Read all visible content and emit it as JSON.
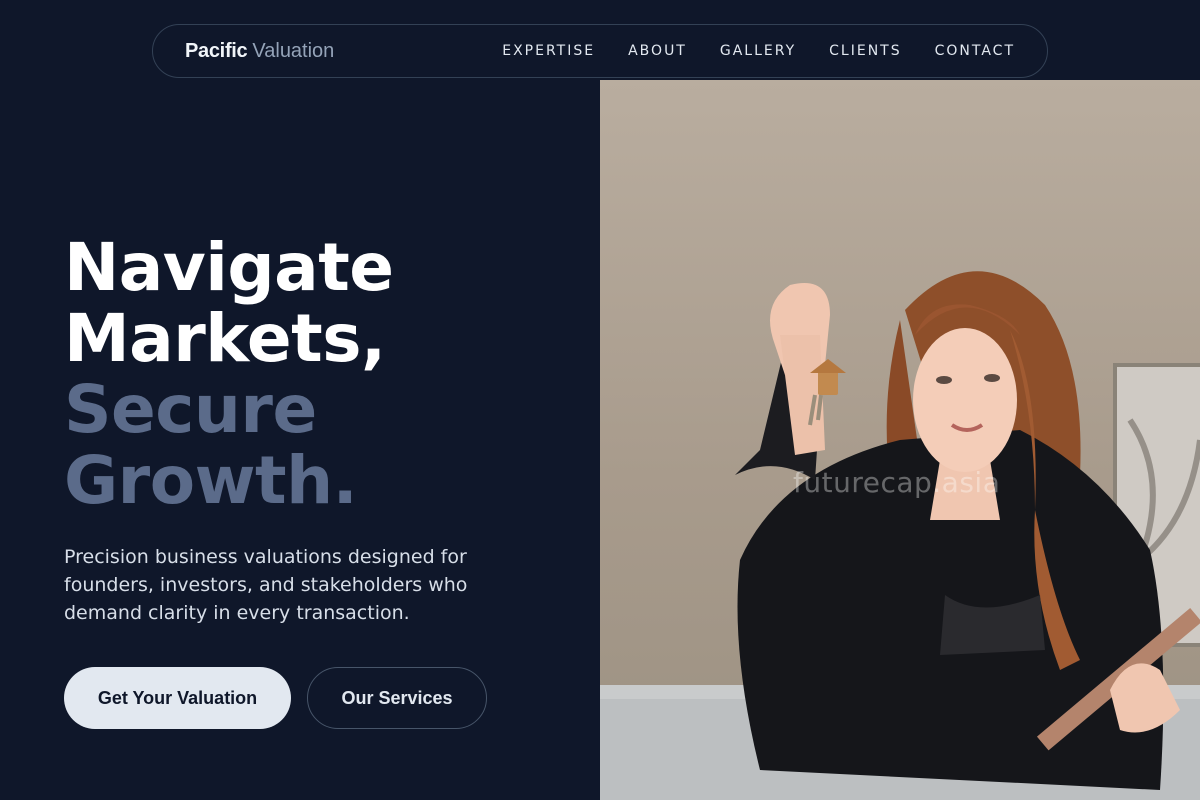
{
  "brand": {
    "bold": "Pacific",
    "light": "Valuation"
  },
  "nav": {
    "items": [
      {
        "label": "EXPERTISE"
      },
      {
        "label": "ABOUT"
      },
      {
        "label": "GALLERY"
      },
      {
        "label": "CLIENTS"
      },
      {
        "label": "CONTACT"
      }
    ]
  },
  "hero": {
    "headline": {
      "line1": "Navigate",
      "line2": "Markets,",
      "line3": "Secure",
      "line4": "Growth."
    },
    "subtext": "Precision business valuations designed for founders, investors, and stakeholders who demand clarity in every transaction.",
    "primary_button": "Get Your Valuation",
    "secondary_button": "Our Services",
    "image": {
      "description_icon": "woman-holding-house-keys-photo",
      "watermark": "futurecap.asia"
    }
  },
  "colors": {
    "background": "#0f172a",
    "accent_muted": "#5b6b8a",
    "button_primary_bg": "#e2e8f0",
    "text_light": "#e2e8f0"
  }
}
